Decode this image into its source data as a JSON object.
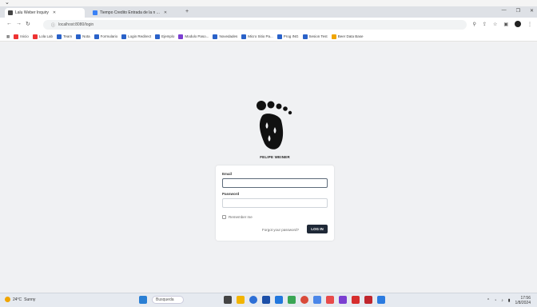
{
  "browser": {
    "tabs": [
      {
        "title": "Lalu Weber Inquiry",
        "active": true
      },
      {
        "title": "Tiempo Credito Entrada de la n ...",
        "active": false
      }
    ],
    "address": "localhost:8080/login",
    "bookmarks": [
      "Inicio",
      "Lola Lab",
      "Team",
      "Nota",
      "Formulario",
      "Login Redirect",
      "Ejemplo",
      "Modulo Paso...",
      "Novedades",
      "Micro Sitio Pa...",
      "Prog ING",
      "Sesion Test",
      "Beer Data Base"
    ]
  },
  "page": {
    "brand": "FELIPE WEINER",
    "form": {
      "email_label": "Email",
      "email_value": "",
      "password_label": "Password",
      "password_value": "",
      "remember_label": "Remember me",
      "forgot_label": "Forgot your password?",
      "submit_label": "LOG IN"
    }
  },
  "taskbar": {
    "weather_temp": "24°C",
    "weather_text": "Sunny",
    "search_label": "Busqueda",
    "time": "17:56",
    "date": "1/8/2024"
  },
  "colors": {
    "page_bg": "#f0f1f3",
    "button_bg": "#1f2937",
    "logo": "#111111"
  }
}
